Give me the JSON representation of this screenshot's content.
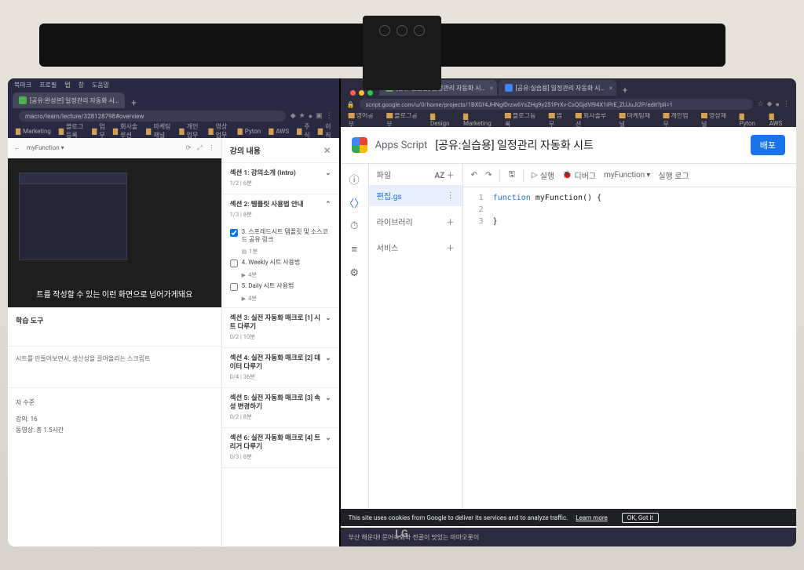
{
  "left": {
    "macmenu": [
      "북마크",
      "프로필",
      "탭",
      "창",
      "도움말"
    ],
    "tab": "[공유:완성본] 일정관리 자동화 시…",
    "url": "macro/learn/lecture/328128798#overview",
    "bookmarks": [
      "Marketing",
      "블로그등록",
      "업무",
      "회사솔루션",
      "마케팅채널",
      "개인업무",
      "영상업무",
      "Pyton",
      "AWS",
      "주식",
      "이직"
    ]
  },
  "course": {
    "panelTitle": "강의 내용",
    "section1": {
      "title": "섹션 1: 강의소개 (Intro)",
      "progress": "1/2 | 6분"
    },
    "section2": {
      "title": "섹션 2: 템플릿 사용법 안내",
      "progress": "1/3 | 8분",
      "lessons": [
        {
          "done": true,
          "title": "3. 스프레드시트 템플릿 및 소스코드 공유 링크",
          "meta": "1분",
          "icon": "file"
        },
        {
          "done": false,
          "title": "4. Weekly 시트 사용법",
          "meta": "4분",
          "icon": "play"
        },
        {
          "done": false,
          "title": "5. Daily 시트 사용법",
          "meta": "4분",
          "icon": "play"
        }
      ]
    },
    "section3": {
      "title": "섹션 3: 실전 자동화 매크로 [1] 시트 다루기",
      "progress": "0/2 | 10분"
    },
    "section4": {
      "title": "섹션 4: 실전 자동화 매크로 [2] 데이터 다루기",
      "progress": "0/4 | 36분"
    },
    "section5": {
      "title": "섹션 5: 실전 자동화 매크로 [3] 속성 변경하기",
      "progress": "0/2 | 8분"
    },
    "section6": {
      "title": "섹션 6: 실전 자동화 매크로 [4] 트리거 다루기",
      "progress": "0/3 | 8분"
    }
  },
  "video": {
    "caption": "트를 작성할 수 있는 이런 화면으로 넘어가게돼요",
    "toolsLabel": "학습 도구",
    "blurb": "시트를 만들어보면서, 생산성을 끌어올리는 스크립트",
    "levelLabel": "자 수준",
    "stat1": "강의: 16",
    "stat2": "동영상: 총 1.5시간"
  },
  "right": {
    "tabs": [
      "[공유:실습용] 일정관리 자동화 시…",
      "[공유:실습용] 일정관리 자동화 시…"
    ],
    "url": "script.google.com/u/0/home/projects/1BXGf4JHNglDrzw6YsZHg9y251PrXv-CsQGjdVl94X1iPrE_ZUJuJi2P/edit?pli=1",
    "bookmarks": [
      "영어공부",
      "블로그공부",
      "Design",
      "Marketing",
      "블로그등록",
      "업무",
      "회사솔루션",
      "마케팅채널",
      "개인업무",
      "영상채널",
      "Pyton",
      "AWS"
    ]
  },
  "appsscript": {
    "brand": "Apps Script",
    "title": "[공유:실습용] 일정관리 자동화 시트",
    "deploy": "배포",
    "filesHeader": "파일",
    "azSort": "AZ",
    "file": "편집.gs",
    "libraries": "라이브러리",
    "services": "서비스",
    "toolbar": {
      "run": "실행",
      "debug": "디버그",
      "func": "myFunction",
      "log": "실행 로그"
    },
    "code": {
      "l1": "function myFunction() {",
      "l2": "",
      "l3": "}"
    }
  },
  "cookie": {
    "text": "This site uses cookies from Google to deliver its services and to analyze traffic.",
    "learn": "Learn more",
    "ok": "OK, Got it"
  },
  "bottomBanner": "부산 해운대! 문어숙회와 전골이 맛있는 마마오롯이"
}
